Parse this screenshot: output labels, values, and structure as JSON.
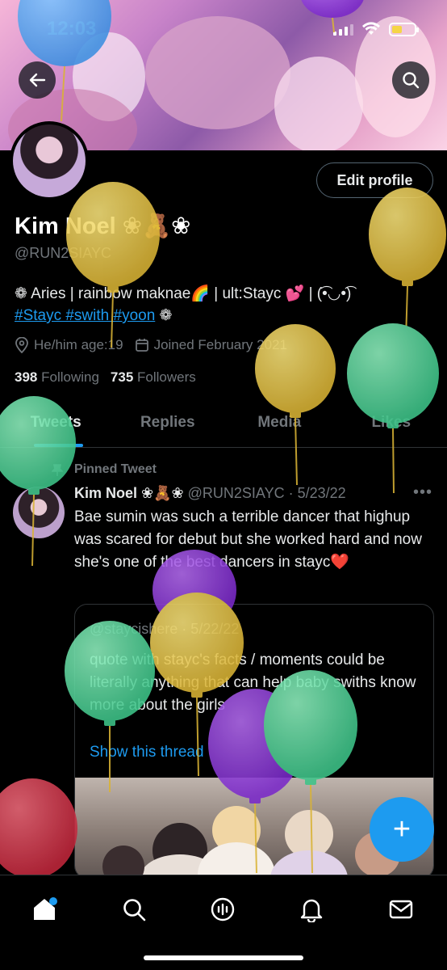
{
  "status_bar": {
    "time": "12:03"
  },
  "profile": {
    "name": "Kim Noel ❀🧸❀",
    "handle": "@RUN2SIAYC",
    "bio_text": "❁ Aries | rainbow maknae🌈 | ult:Stayc 💕 | (͡•◡•͡)",
    "bio_tags": "#Stayc #swith #yoon",
    "bio_end": " ❁",
    "pronouns": "He/him age:19",
    "joined": "Joined February 2021",
    "following_count": "398",
    "following_label": "Following",
    "followers_count": "735",
    "followers_label": "Followers",
    "edit_button": "Edit profile"
  },
  "tabs": [
    {
      "label": "Tweets",
      "active": true
    },
    {
      "label": "Replies"
    },
    {
      "label": "Media"
    },
    {
      "label": "Likes"
    }
  ],
  "tweet": {
    "pinned_label": "Pinned Tweet",
    "author": "Kim Noel ❀🧸❀",
    "meta": "@RUN2SIAYC · 5/23/22",
    "text": "Bae sumin was such a terrible dancer that highup was scared for debut but she worked hard and now she's one of the best dancers in stayc❤️",
    "quote": {
      "head": "@staycishere · 5/22/22",
      "text": "quote with stayc's facts / moments could be literally anything that can help baby swiths know more about the girls",
      "link": "Show this thread"
    }
  },
  "fab_label": "+",
  "colors": {
    "accent": "#1d9bf0",
    "background": "#000000",
    "muted": "#71767b"
  }
}
